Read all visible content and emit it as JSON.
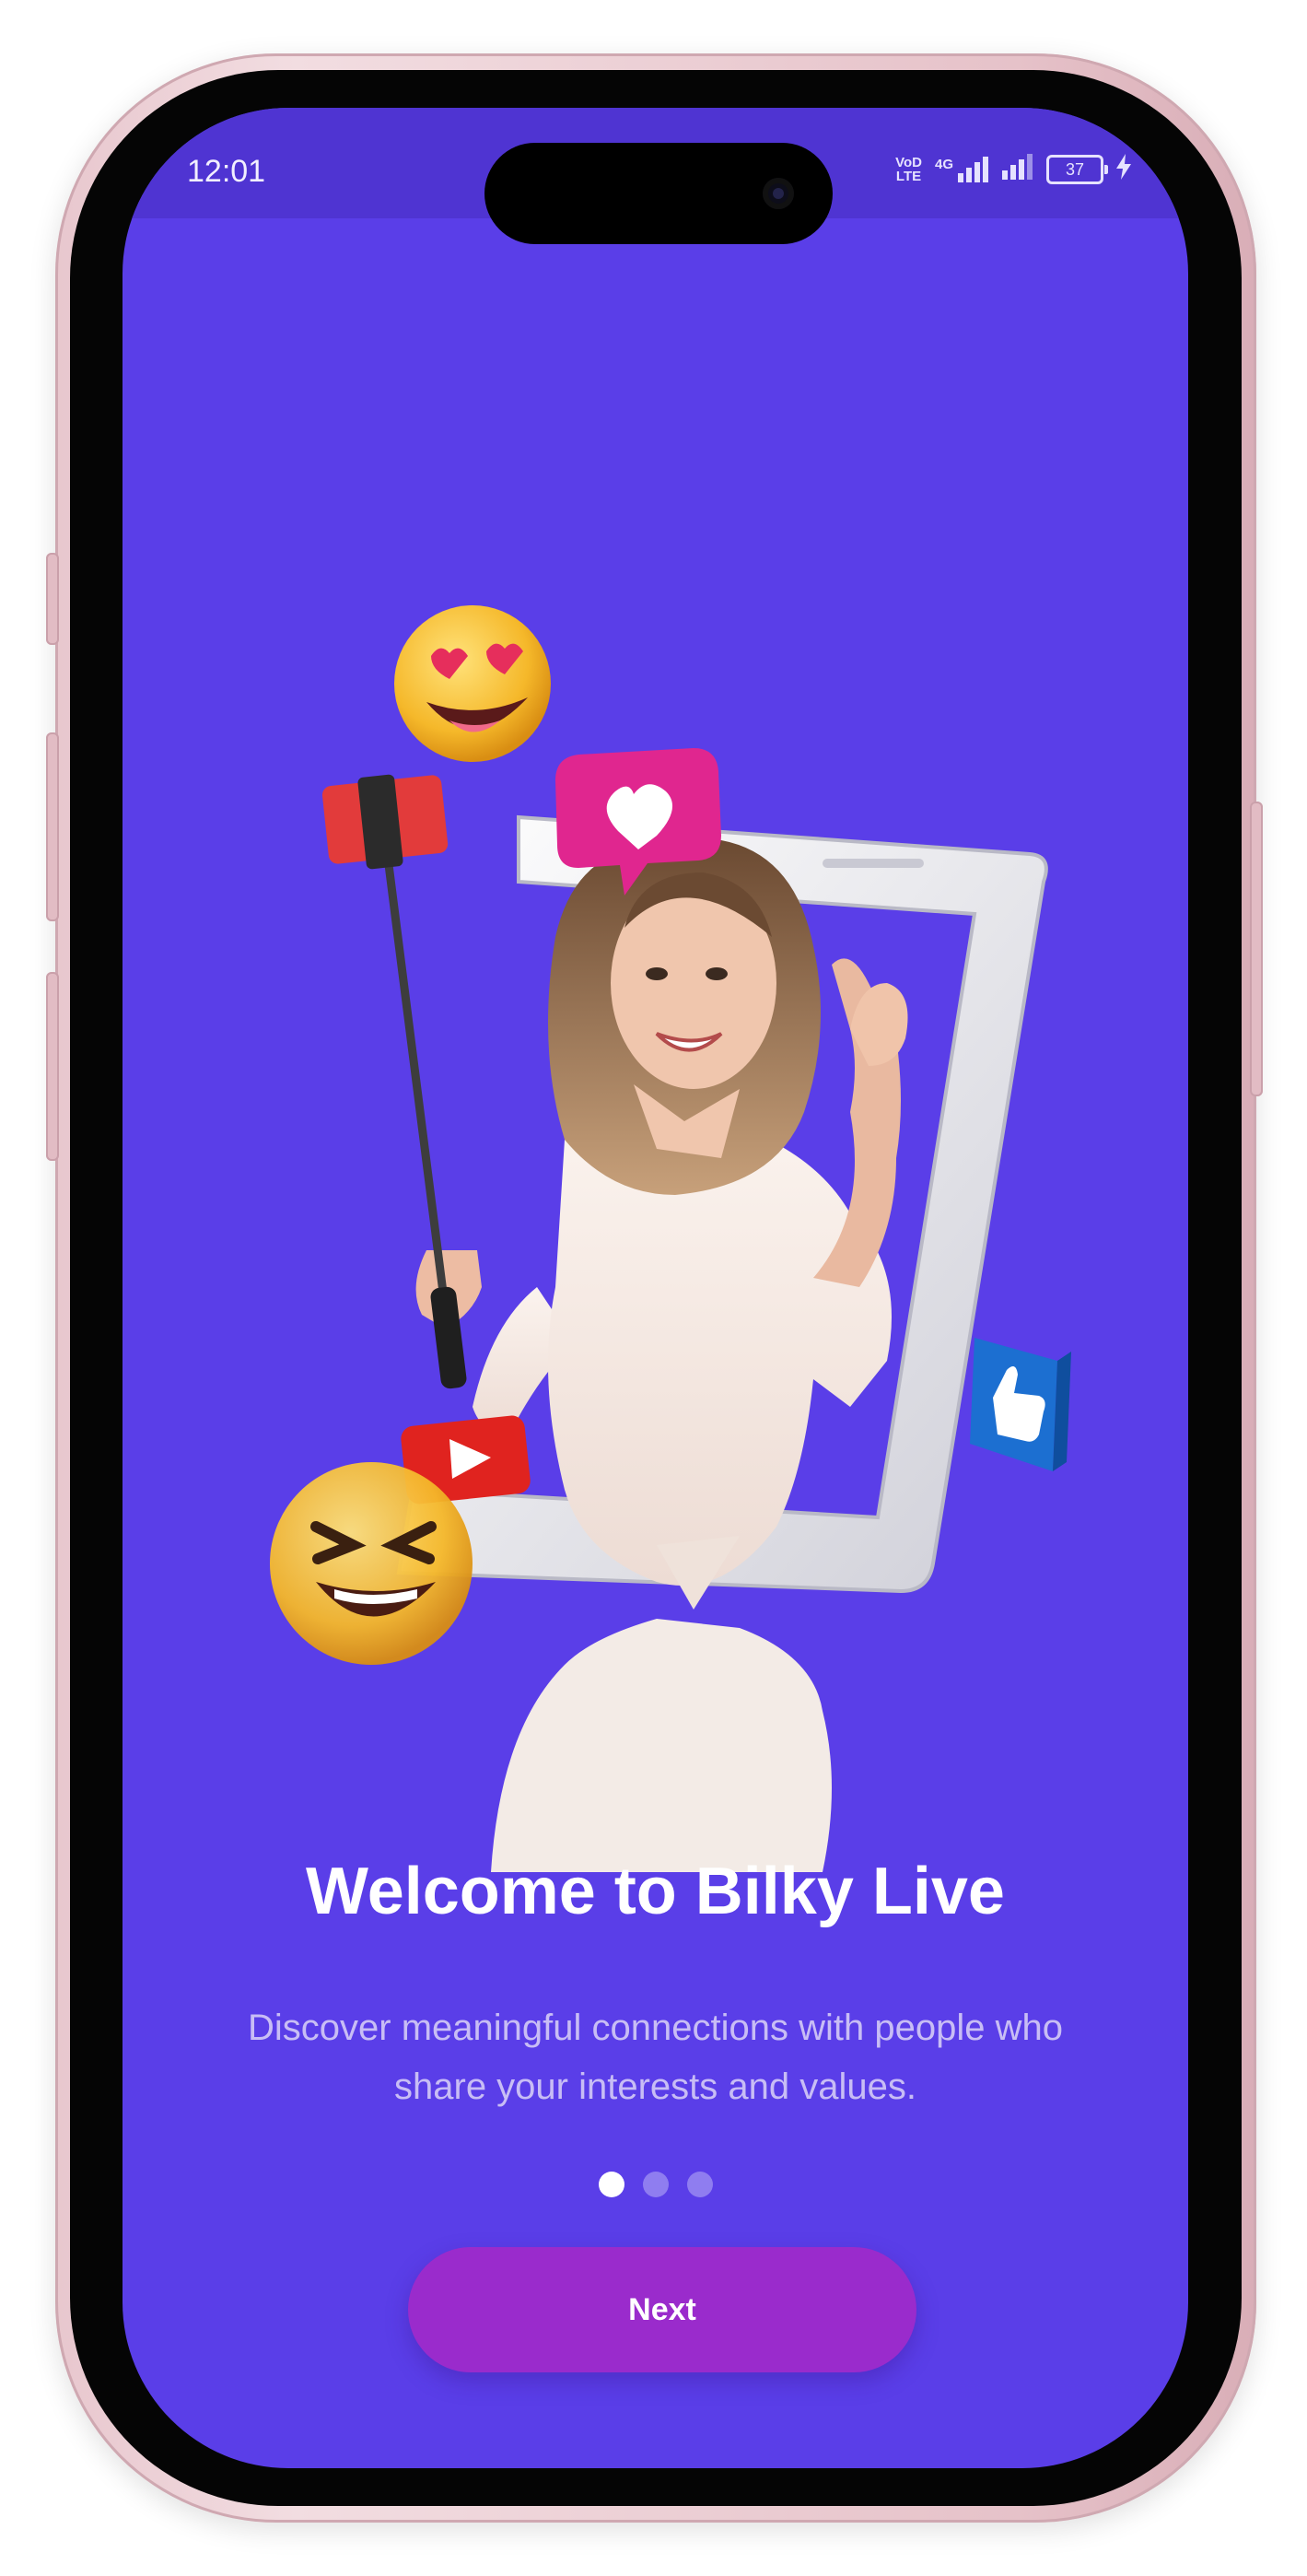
{
  "status_bar": {
    "time": "12:01",
    "network_label_top": "VoD",
    "network_label_bottom": "LTE",
    "network_type": "4G",
    "battery_level": "37"
  },
  "onboarding": {
    "title": "Welcome to Bilky Live",
    "subtitle_line1": "Discover meaningful connections with people who",
    "subtitle_line2": "share your interests and values.",
    "page_indicator": {
      "current": 1,
      "total": 3
    },
    "next_label": "Next"
  },
  "colors": {
    "background": "#5a3ee8",
    "status_bar": "#4f34d2",
    "button": "#9a2bcc",
    "dot_active": "#ffffff",
    "dot_inactive": "#8f7df0"
  }
}
